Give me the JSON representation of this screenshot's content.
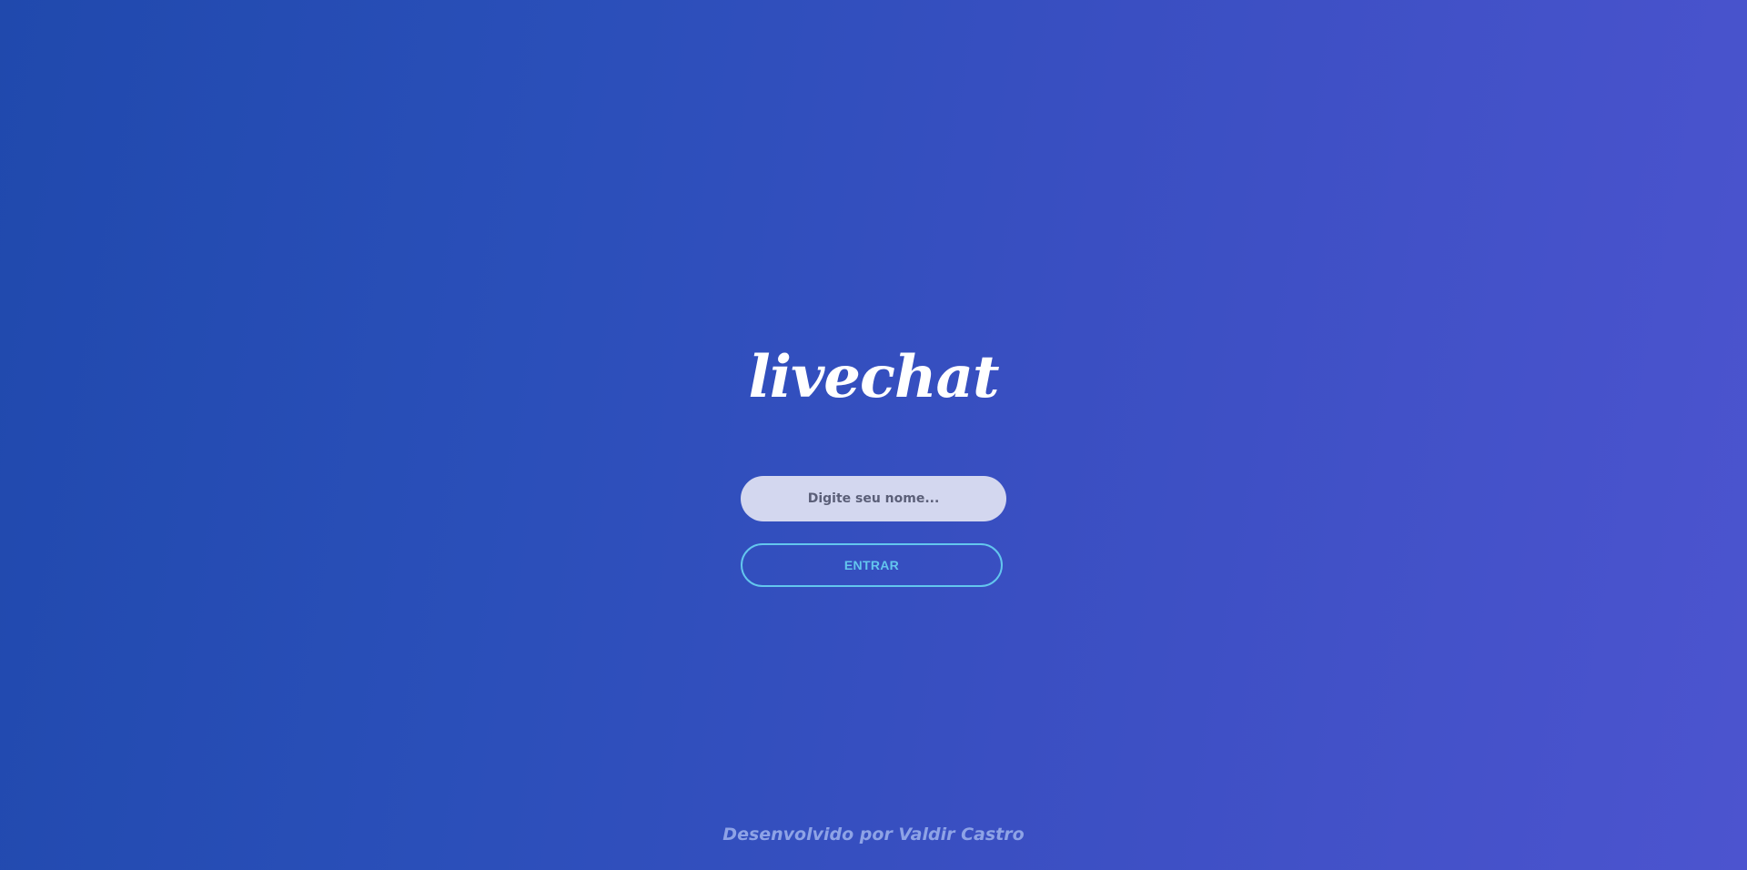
{
  "app": {
    "logo_text": "livechat"
  },
  "login_form": {
    "name_input": {
      "value": "",
      "placeholder": "Digite seu nome..."
    },
    "enter_button_label": "ENTRAR"
  },
  "footer": {
    "credit_text": "Desenvolvido por Valdir Castro"
  },
  "colors": {
    "background_start": "#2049ad",
    "background_end": "#4c54cf",
    "logo": "#ffffff",
    "input_background": "#d3d7ef",
    "button_accent": "#63c6ee",
    "footer_text": "#8ea3e6"
  }
}
